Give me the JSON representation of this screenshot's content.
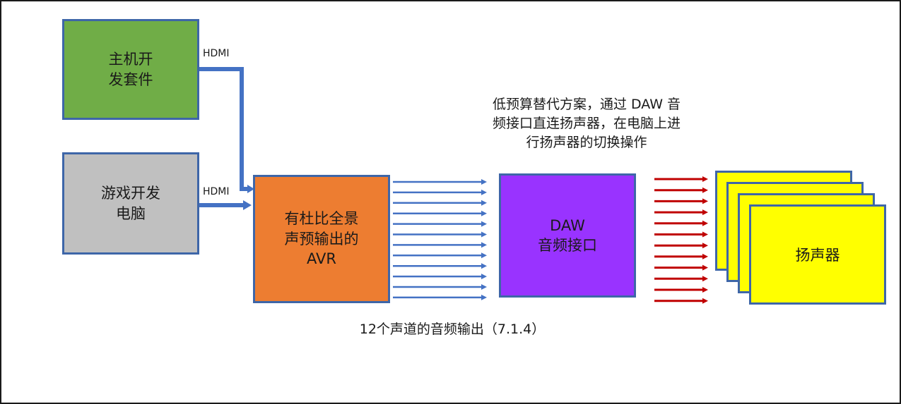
{
  "nodes": {
    "console_kit": "主机开\n发套件",
    "game_pc": "游戏开发\n电脑",
    "avr": "有杜比全景\n声预输出的\nAVR",
    "daw_interface": "DAW\n音频接口",
    "speakers": "扬声器"
  },
  "edges": {
    "hdmi_top": "HDMI",
    "hdmi_bottom": "HDMI"
  },
  "annotations": {
    "alt_solution": "低预算替代方案，通过 DAW 音\n频接口直连扬声器，在电脑上进\n行扬声器的切换操作",
    "channel_output": "12个声道的音频输出（7.1.4）"
  },
  "colors": {
    "connector": "#4472c4",
    "audio_arrow_blue": "#4472c4",
    "audio_arrow_red": "#c00000",
    "console_kit_fill": "#70ad47",
    "game_pc_fill": "#c0c0c0",
    "avr_fill": "#ed7d31",
    "daw_fill": "#9933ff",
    "speaker_fill": "#ffff00"
  }
}
